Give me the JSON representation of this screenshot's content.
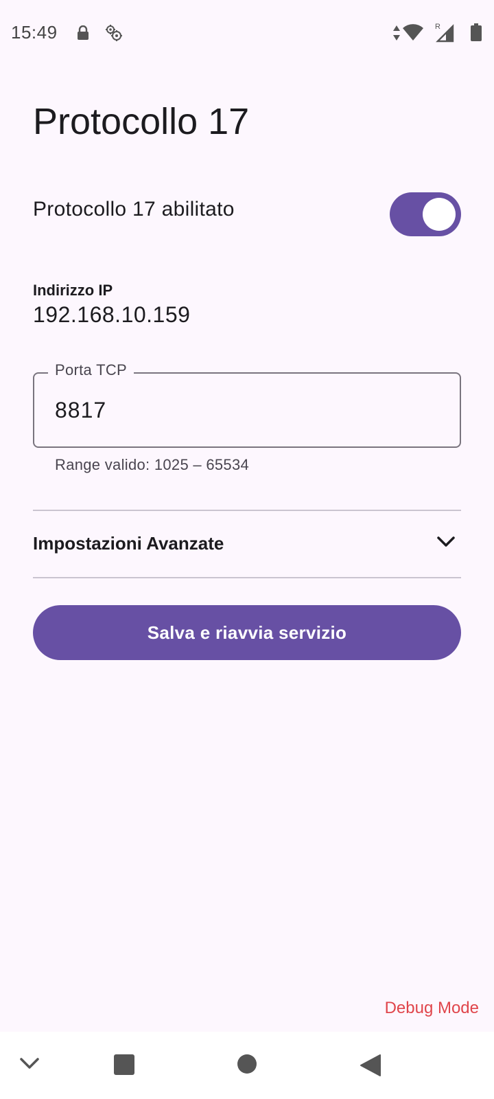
{
  "status_bar": {
    "time": "15:49",
    "icons": [
      "lock-icon",
      "settings-sync-icon",
      "data-arrows-icon",
      "wifi-icon",
      "signal-roaming-icon",
      "battery-icon"
    ],
    "roaming_indicator": "R"
  },
  "page": {
    "title": "Protocollo 17"
  },
  "toggle": {
    "label": "Protocollo 17 abilitato",
    "enabled": true
  },
  "ip": {
    "label": "Indirizzo IP",
    "value": "192.168.10.159"
  },
  "port_field": {
    "label": "Porta TCP",
    "value": "8817",
    "helper": "Range valido: 1025 – 65534"
  },
  "advanced": {
    "label": "Impostazioni Avanzate",
    "expanded": false
  },
  "actions": {
    "save_label": "Salva e riavvia servizio"
  },
  "footer": {
    "debug_label": "Debug Mode"
  },
  "nav_bar": {
    "icons": [
      "chevron-down-icon",
      "recents-icon",
      "home-icon",
      "back-icon"
    ]
  },
  "colors": {
    "background": "#FDF7FE",
    "primary": "#6750A4",
    "debug": "#E0454B",
    "outline": "#79747E",
    "divider": "#CAC4D0"
  }
}
